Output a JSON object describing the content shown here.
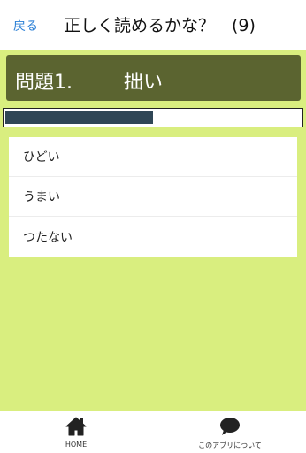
{
  "header": {
    "back_label": "戻る",
    "title": "正しく読めるかな？　(9)"
  },
  "question": {
    "label": "問題1.",
    "word": "拙い"
  },
  "progress": {
    "fraction": 0.5
  },
  "choices": [
    {
      "label": "ひどい"
    },
    {
      "label": "うまい"
    },
    {
      "label": "つたない"
    }
  ],
  "tabbar": {
    "home": {
      "label": "HOME",
      "icon": "home-icon"
    },
    "about": {
      "label": "このアプリについて",
      "icon": "chat-bubble-icon"
    }
  },
  "colors": {
    "background": "#d9ee7f",
    "question_box": "#5b6430",
    "progress_fill": "#2f4656",
    "link": "#2a7fd6"
  }
}
